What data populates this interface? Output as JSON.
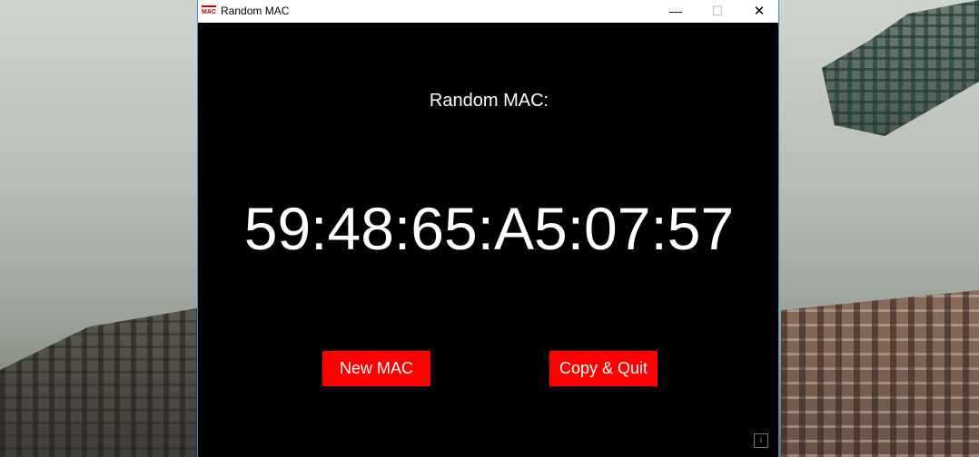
{
  "window": {
    "title": "Random MAC",
    "app_icon_text": "MAC",
    "icon": "mac-app-icon",
    "controls": {
      "minimize": "—",
      "maximize": "☐",
      "close": "✕"
    }
  },
  "main": {
    "label": "Random MAC:",
    "mac_address": "59:48:65:A5:07:57"
  },
  "actions": {
    "new_mac_label": "New MAC",
    "copy_quit_label": "Copy & Quit"
  },
  "footer": {
    "info_glyph": "i"
  },
  "colors": {
    "background": "#000000",
    "text": "#ffffff",
    "button": "#ff0000",
    "titlebar": "#ffffff"
  }
}
